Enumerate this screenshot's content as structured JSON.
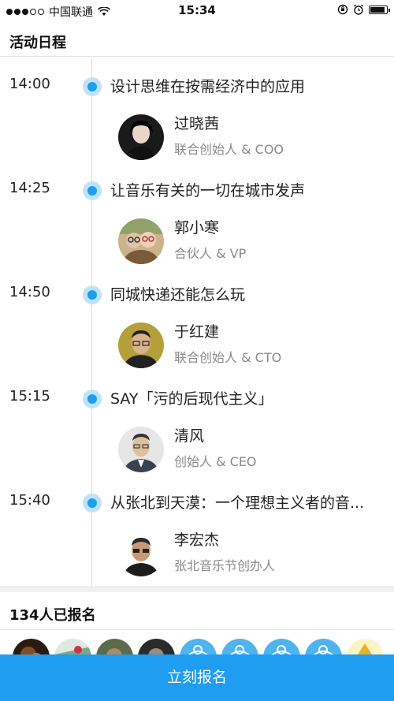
{
  "status_bar": {
    "carrier": "中国联通",
    "time": "15:34",
    "battery_level": 0.9
  },
  "schedule": {
    "title": "活动日程",
    "sessions": [
      {
        "time": "14:00",
        "title": "设计思维在按需经济中的应用",
        "speaker": "过晓茜",
        "role": "联合创始人 & COO"
      },
      {
        "time": "14:25",
        "title": "让音乐有关的一切在城市发声",
        "speaker": "郭小寒",
        "role": "合伙人 & VP"
      },
      {
        "time": "14:50",
        "title": "同城快递还能怎么玩",
        "speaker": "于红建",
        "role": "联合创始人 & CTO"
      },
      {
        "time": "15:15",
        "title": "SAY「污的后现代主义」",
        "speaker": "清风",
        "role": "创始人 & CEO"
      },
      {
        "time": "15:40",
        "title": "从张北到天漠：一个理想主义者的音...",
        "speaker": "李宏杰",
        "role": "张北音乐节创办人"
      }
    ]
  },
  "registration": {
    "title": "134人已报名",
    "button_label": "立刻报名"
  },
  "colors": {
    "accent": "#1e9df1",
    "node_halo": "#bfe3fb",
    "secondary_text": "#8a8a8a"
  }
}
